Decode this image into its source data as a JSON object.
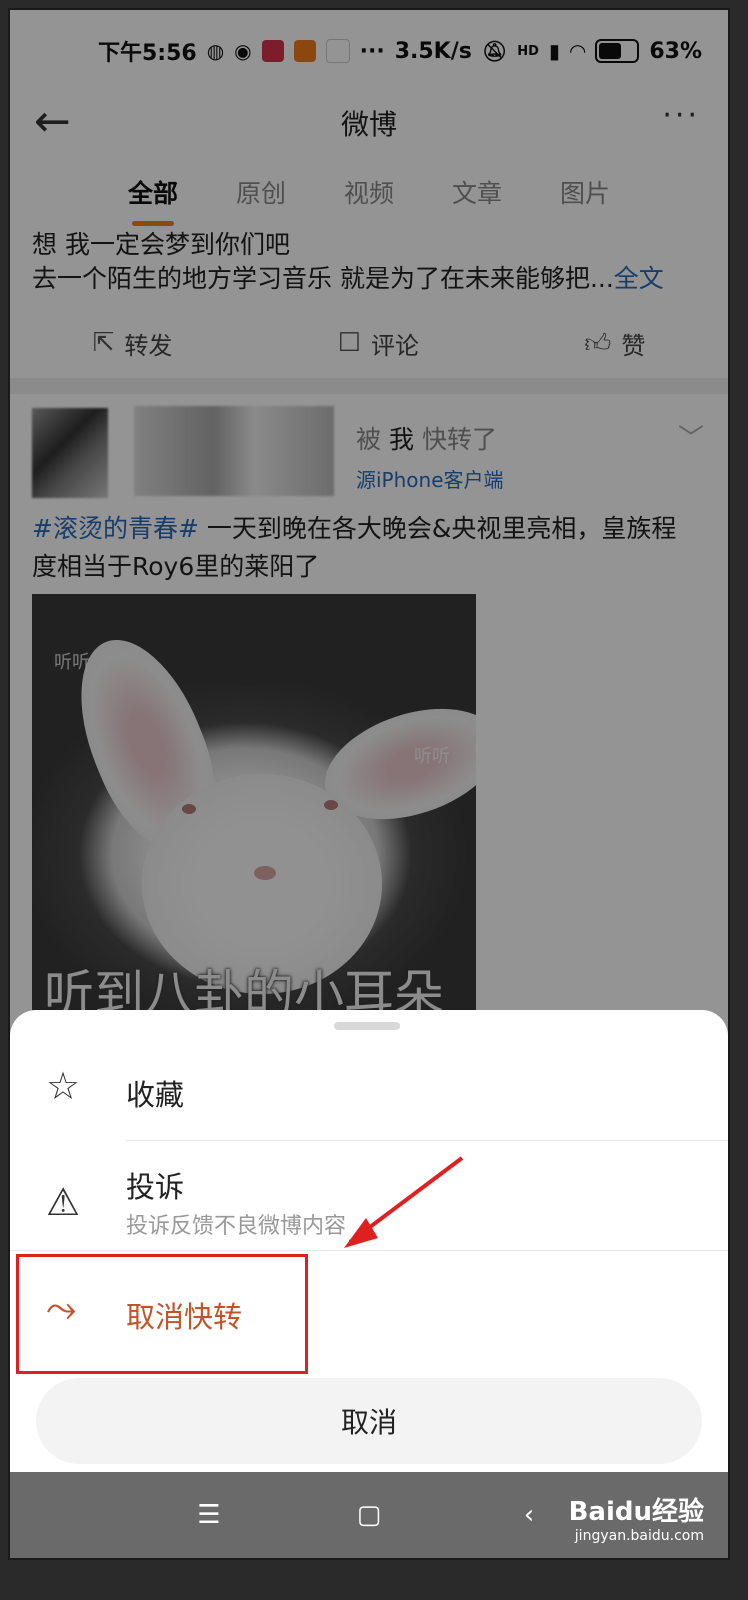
{
  "status_bar": {
    "time": "下午5:56",
    "net_speed": "3.5K/s",
    "signal_label": "HD",
    "battery": "63%",
    "battery_level": 0.63
  },
  "header": {
    "title": "微博",
    "more_label": "···"
  },
  "tabs": [
    {
      "label": "全部",
      "active": true
    },
    {
      "label": "原创",
      "active": false
    },
    {
      "label": "视频",
      "active": false
    },
    {
      "label": "文章",
      "active": false
    },
    {
      "label": "图片",
      "active": false
    }
  ],
  "post": {
    "line1": "想 我一定会梦到你们吧",
    "line2": "去一个陌生的地方学习音乐 就是为了在未来能够把...",
    "full_text_link": "全文"
  },
  "actions": {
    "repost": "转发",
    "comment": "评论",
    "like": "赞"
  },
  "repost_card": {
    "note_prefix": "被",
    "note_me": "我",
    "note_suffix": "快转了",
    "source": "源iPhone客户端",
    "hashtag": "#滚烫的青春#",
    "text": " 一天到晚在各大晚会&央视里亮相，皇族程度相当于Roy6里的莱阳了",
    "image": {
      "watermark1": "听听",
      "watermark2": "听听",
      "caption": "听到八卦的小耳朵"
    }
  },
  "sheet": {
    "favorite_label": "收藏",
    "report_label": "投诉",
    "report_sub": "投诉反馈不良微博内容",
    "unrepost_label": "取消快转",
    "cancel_label": "取消"
  },
  "watermark": {
    "main": "Baidu经验",
    "sub": "jingyan.baidu.com"
  },
  "colors": {
    "accent_orange": "#f08300",
    "link_blue": "#2a6ab8",
    "unrepost_red": "#c3532b",
    "highlight_red": "#e02020"
  }
}
